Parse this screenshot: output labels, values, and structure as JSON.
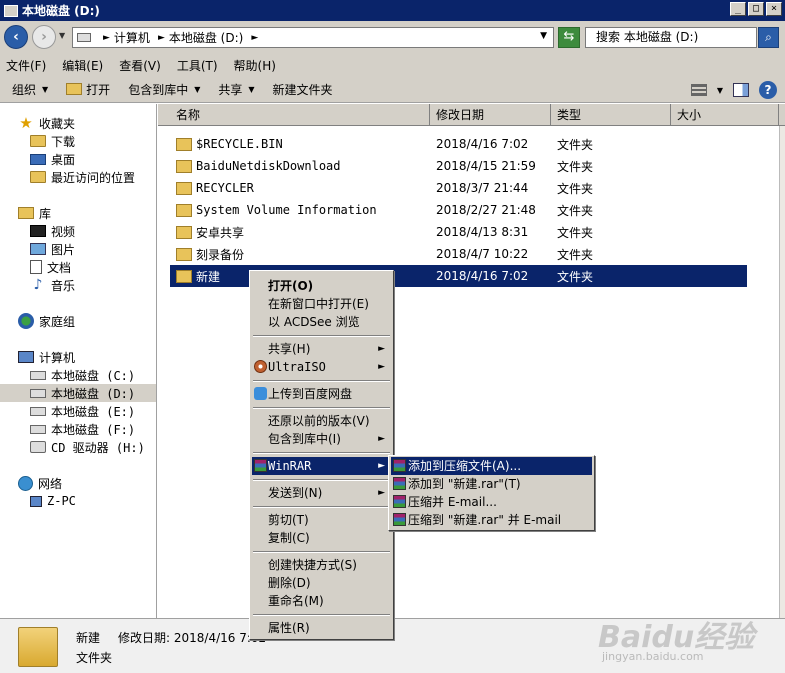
{
  "window": {
    "title": "本地磁盘 (D:)",
    "controls": [
      "_",
      "□",
      "×"
    ]
  },
  "address": {
    "crumbs": [
      "计算机",
      "本地磁盘 (D:)"
    ],
    "search_placeholder": "搜索 本地磁盘 (D:)"
  },
  "menubar": [
    "文件(F)",
    "编辑(E)",
    "查看(V)",
    "工具(T)",
    "帮助(H)"
  ],
  "toolbar": {
    "organize": "组织",
    "open": "打开",
    "include": "包含到库中",
    "share": "共享",
    "new_folder": "新建文件夹"
  },
  "nav": {
    "favorites": "收藏夹",
    "downloads": "下载",
    "desktop": "桌面",
    "recent": "最近访问的位置",
    "libraries": "库",
    "videos": "视频",
    "pictures": "图片",
    "documents": "文档",
    "music": "音乐",
    "homegroup": "家庭组",
    "computer": "计算机",
    "drive_c": "本地磁盘 (C:)",
    "drive_d": "本地磁盘 (D:)",
    "drive_e": "本地磁盘 (E:)",
    "drive_f": "本地磁盘 (F:)",
    "drive_h": "CD 驱动器 (H:)",
    "network": "网络",
    "zpc": "Z-PC"
  },
  "columns": {
    "name": "名称",
    "date": "修改日期",
    "type": "类型",
    "size": "大小"
  },
  "files": [
    {
      "name": "$RECYCLE.BIN",
      "date": "2018/4/16 7:02",
      "type": "文件夹"
    },
    {
      "name": "BaiduNetdiskDownload",
      "date": "2018/4/15 21:59",
      "type": "文件夹"
    },
    {
      "name": "RECYCLER",
      "date": "2018/3/7 21:44",
      "type": "文件夹"
    },
    {
      "name": "System Volume Information",
      "date": "2018/2/27 21:48",
      "type": "文件夹"
    },
    {
      "name": "安卓共享",
      "date": "2018/4/13 8:31",
      "type": "文件夹"
    },
    {
      "name": "刻录备份",
      "date": "2018/4/7 10:22",
      "type": "文件夹"
    },
    {
      "name": "新建",
      "date": "2018/4/16 7:02",
      "type": "文件夹"
    }
  ],
  "context_menu": {
    "open": "打开(O)",
    "open_new": "在新窗口中打开(E)",
    "acdsee": "以 ACDSee 浏览",
    "share": "共享(H)",
    "ultraiso": "UltraISO",
    "baidu": "上传到百度网盘",
    "restore": "还原以前的版本(V)",
    "include": "包含到库中(I)",
    "winrar": "WinRAR",
    "sendto": "发送到(N)",
    "cut": "剪切(T)",
    "copy": "复制(C)",
    "shortcut": "创建快捷方式(S)",
    "delete": "删除(D)",
    "rename": "重命名(M)",
    "properties": "属性(R)"
  },
  "winrar_menu": [
    "添加到压缩文件(A)...",
    "添加到 \"新建.rar\"(T)",
    "压缩并 E-mail...",
    "压缩到 \"新建.rar\" 并 E-mail"
  ],
  "details": {
    "name": "新建",
    "meta": "修改日期: 2018/4/16 7:02",
    "type": "文件夹"
  },
  "watermark": {
    "main": "Baidu经验",
    "sub": "jingyan.baidu.com"
  }
}
